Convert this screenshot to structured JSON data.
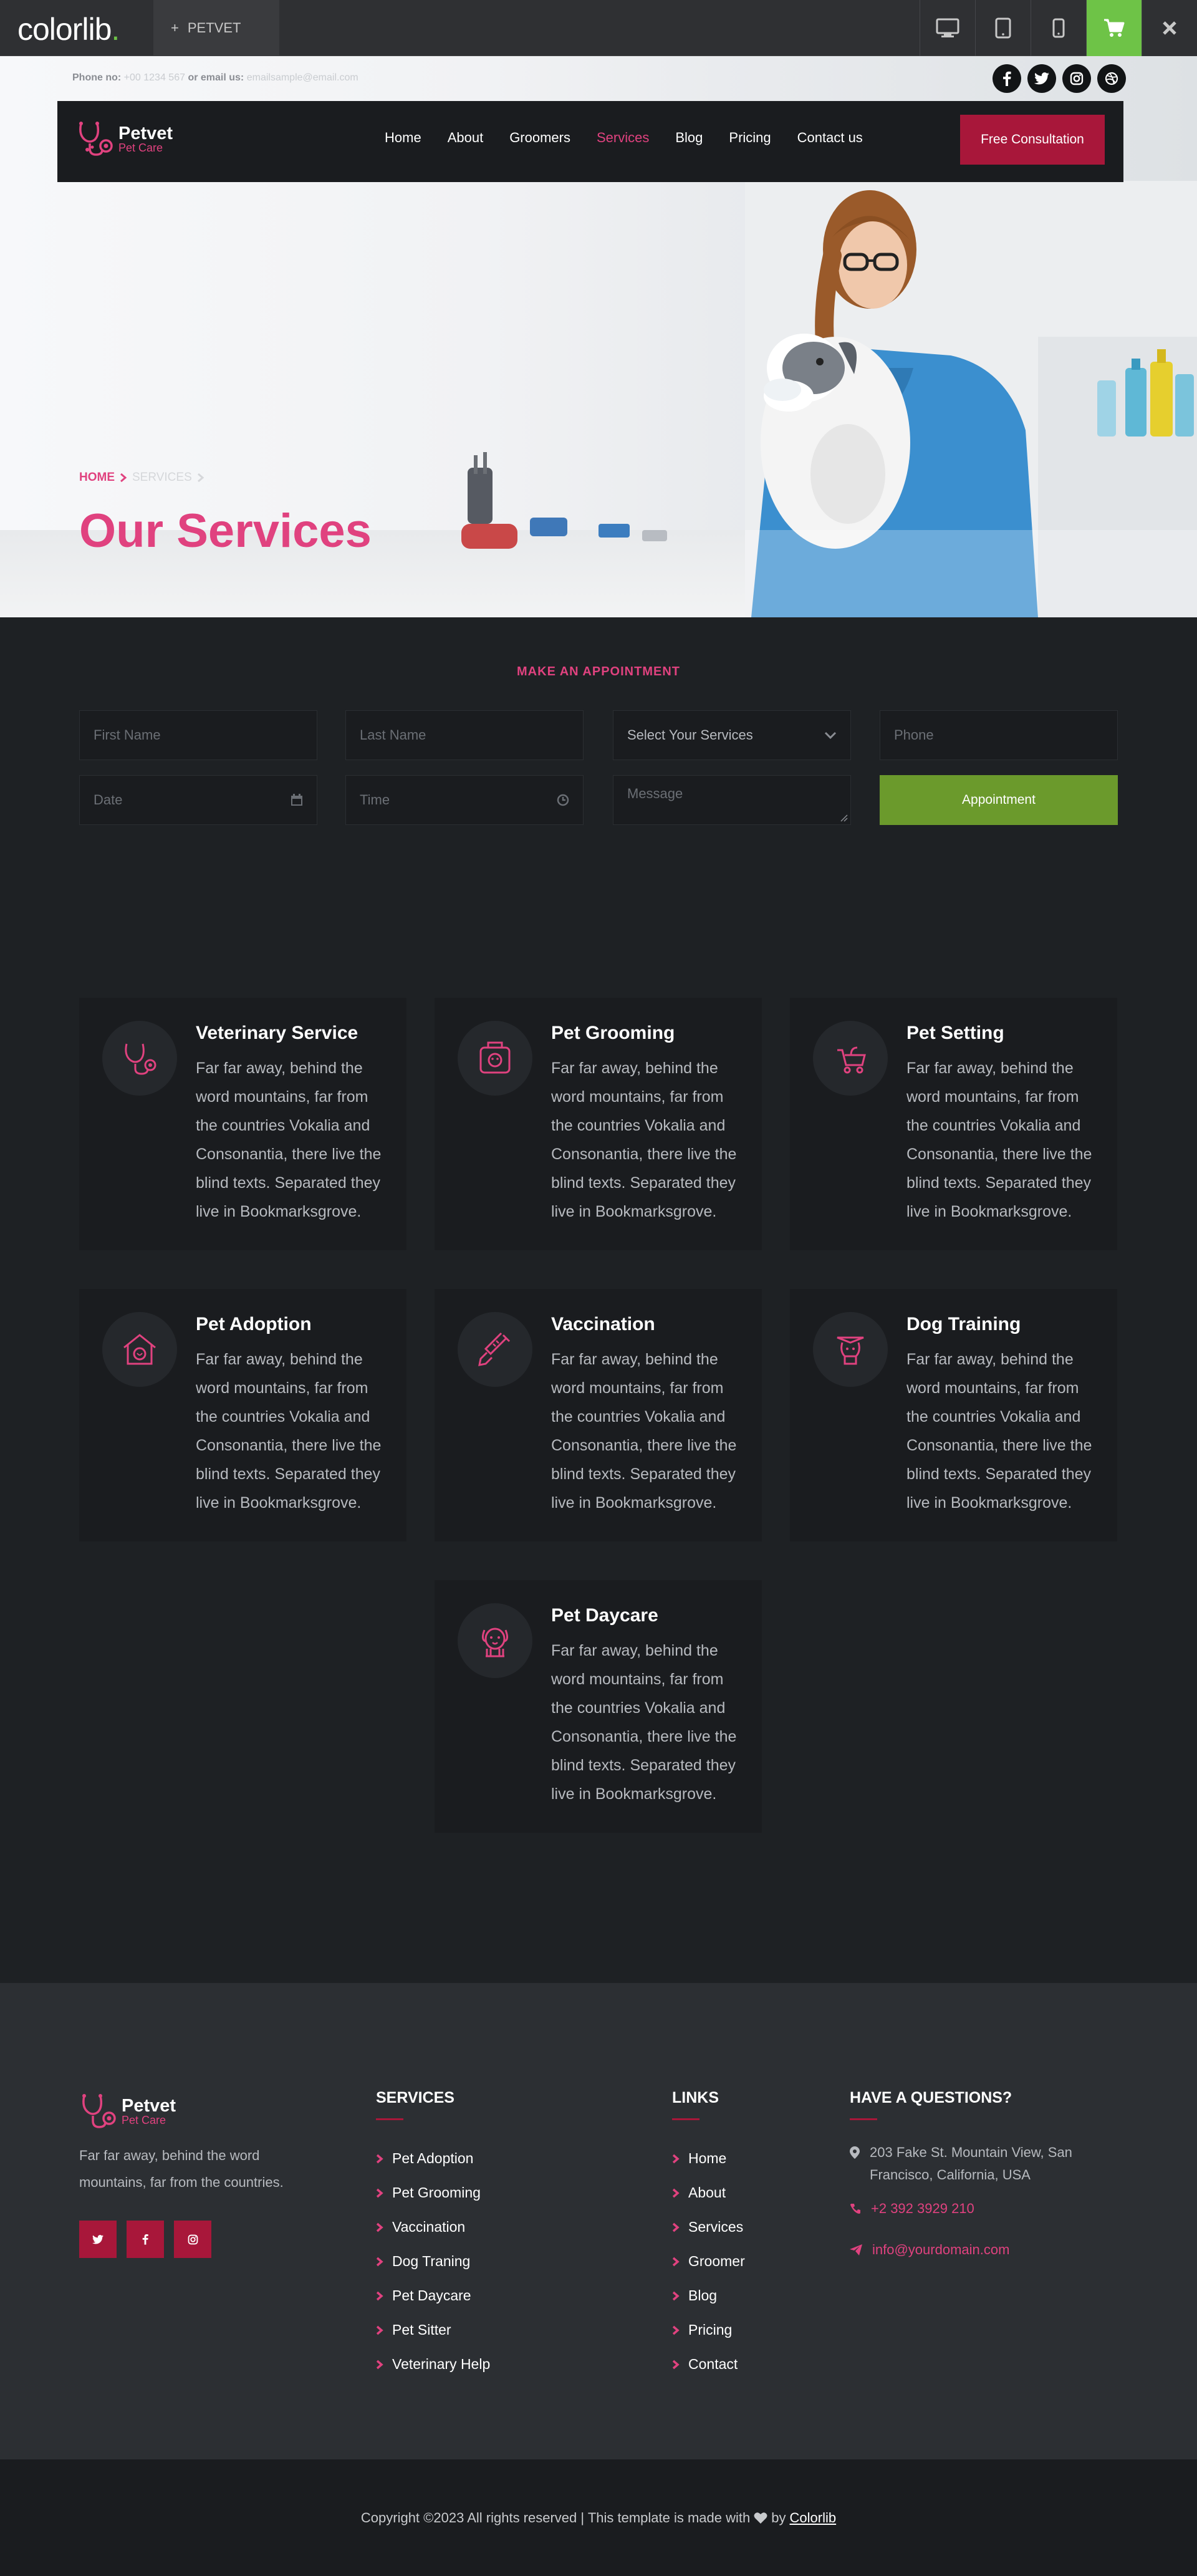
{
  "topbar": {
    "brand": "colorlib",
    "brand_dot": ".",
    "theme_tab": "PETVET"
  },
  "header": {
    "phone_label": "Phone no:",
    "phone_value": "+00 1234 567",
    "email_label": "or email us:",
    "email_value": "emailsample@email.com"
  },
  "nav": {
    "logo_name": "Petvet",
    "logo_sub": "Pet Care",
    "items": [
      "Home",
      "About",
      "Groomers",
      "Services",
      "Blog",
      "Pricing",
      "Contact us"
    ],
    "active": "Services",
    "cta": "Free Consultation"
  },
  "hero": {
    "breadcrumb_home": "HOME",
    "breadcrumb_current": "SERVICES",
    "title": "Our Services"
  },
  "appointment": {
    "kicker": "MAKE AN APPOINTMENT",
    "first_name": "First Name",
    "last_name": "Last Name",
    "select_services": "Select Your Services",
    "phone": "Phone",
    "date": "Date",
    "time": "Time",
    "message": "Message",
    "button": "Appointment"
  },
  "services": [
    {
      "title": "Veterinary Service",
      "desc": "Far far away, behind the word mountains, far from the countries Vokalia and Consonantia, there live the blind texts. Separated they live in Bookmarksgrove.",
      "icon": "stethoscope-icon"
    },
    {
      "title": "Pet Grooming",
      "desc": "Far far away, behind the word mountains, far from the countries Vokalia and Consonantia, there live the blind texts. Separated they live in Bookmarksgrove.",
      "icon": "grooming-icon"
    },
    {
      "title": "Pet Setting",
      "desc": "Far far away, behind the word mountains, far from the countries Vokalia and Consonantia, there live the blind texts. Separated they live in Bookmarksgrove.",
      "icon": "pet-stroller-icon"
    },
    {
      "title": "Pet Adoption",
      "desc": "Far far away, behind the word mountains, far from the countries Vokalia and Consonantia, there live the blind texts. Separated they live in Bookmarksgrove.",
      "icon": "pet-house-icon"
    },
    {
      "title": "Vaccination",
      "desc": "Far far away, behind the word mountains, far from the countries Vokalia and Consonantia, there live the blind texts. Separated they live in Bookmarksgrove.",
      "icon": "syringe-icon"
    },
    {
      "title": "Dog Training",
      "desc": "Far far away, behind the word mountains, far from the countries Vokalia and Consonantia, there live the blind texts. Separated they live in Bookmarksgrove.",
      "icon": "dog-training-icon"
    },
    {
      "title": "Pet Daycare",
      "desc": "Far far away, behind the word mountains, far from the countries Vokalia and Consonantia, there live the blind texts. Separated they live in Bookmarksgrove.",
      "icon": "dog-face-icon"
    }
  ],
  "footer": {
    "logo_name": "Petvet",
    "logo_sub": "Pet Care",
    "about": "Far far away, behind the word mountains, far from the countries.",
    "services_heading": "SERVICES",
    "services_links": [
      "Pet Adoption",
      "Pet Grooming",
      "Vaccination",
      "Dog Traning",
      "Pet Daycare",
      "Pet Sitter",
      "Veterinary Help"
    ],
    "links_heading": "LINKS",
    "links": [
      "Home",
      "About",
      "Services",
      "Groomer",
      "Blog",
      "Pricing",
      "Contact"
    ],
    "contact_heading": "HAVE A QUESTIONS?",
    "address": "203 Fake St. Mountain View, San Francisco, California, USA",
    "phone": "+2 392 3929 210",
    "email": "info@yourdomain.com"
  },
  "copyright": {
    "text": "Copyright ©2023 All rights reserved | This template is made with",
    "by": "by",
    "link": "Colorlib"
  },
  "colors": {
    "accent": "#e0427f",
    "cta": "#a8173a",
    "green": "#6b9a2c",
    "cart": "#6ec347"
  }
}
